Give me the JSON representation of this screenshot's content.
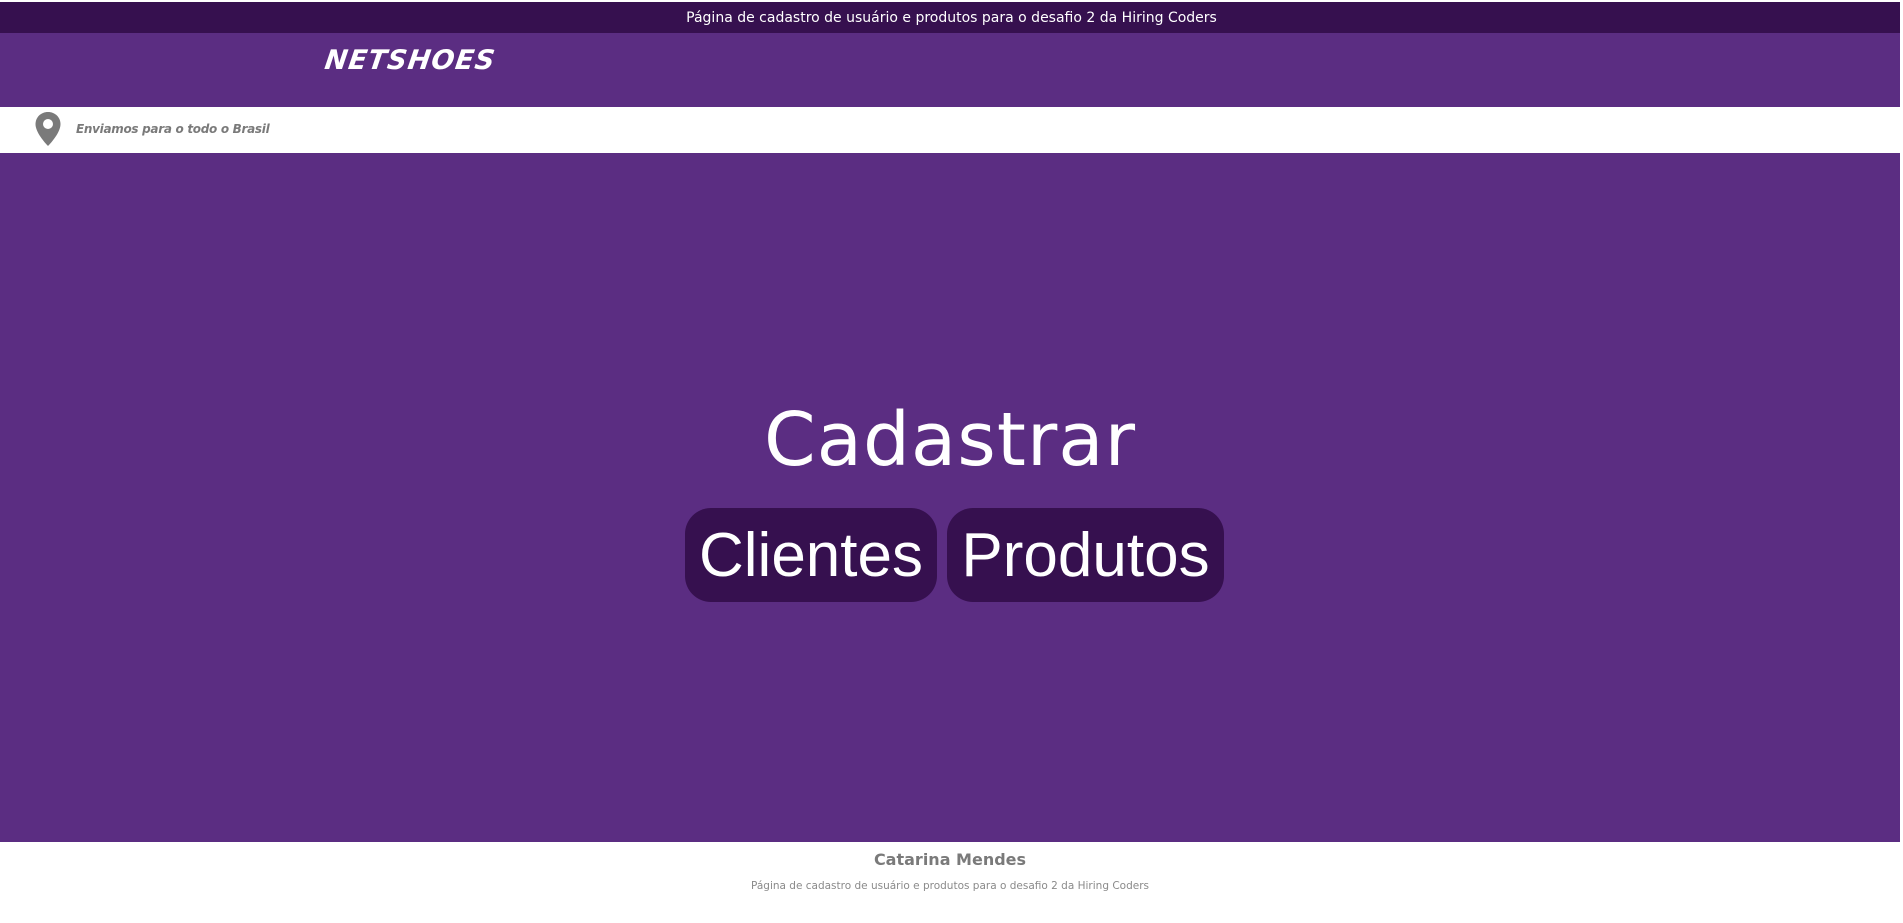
{
  "top_bar": {
    "text": "Página de cadastro de usuário e produtos para o desafio 2 da Hiring Coders"
  },
  "header": {
    "logo_text": "NETSHOES"
  },
  "shipping": {
    "icon": "location-pin-icon",
    "text": "Enviamos para o todo o Brasil"
  },
  "main": {
    "title": "Cadastrar",
    "buttons": {
      "clientes_label": "Clientes",
      "produtos_label": "Produtos"
    }
  },
  "footer": {
    "name": "Catarina Mendes",
    "description": "Página de cadastro de usuário e produtos para o desafio 2 da Hiring Coders"
  },
  "colors": {
    "brand_purple": "#5b2d82",
    "dark_purple": "#36104f",
    "muted_text": "#7a7a7a"
  }
}
